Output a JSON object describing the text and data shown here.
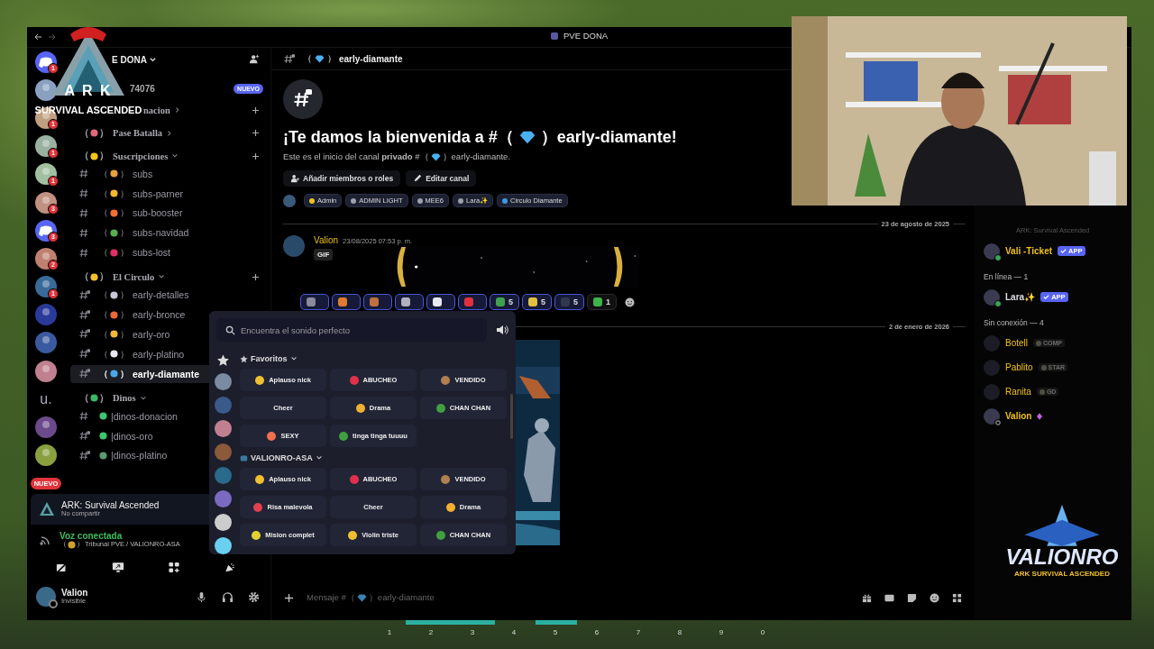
{
  "window": {
    "title": "PVE DONA"
  },
  "overlays": {
    "top_logo": {
      "title": "A R K",
      "subtitle": "SURVIVAL ASCENDED"
    },
    "bottom_logo": {
      "title": "VALIONRO",
      "subtitle": "ARK SURVIVAL ASCENDED"
    }
  },
  "server_rail": [
    {
      "kind": "discord",
      "badge": "1"
    },
    {
      "kind": "avatar"
    },
    {
      "kind": "avatar",
      "badge": "1"
    },
    {
      "kind": "avatar",
      "badge": "1"
    },
    {
      "kind": "avatar",
      "badge": "1"
    },
    {
      "kind": "avatar",
      "badge": "3"
    },
    {
      "kind": "discord",
      "badge": "3"
    },
    {
      "kind": "avatar",
      "badge": "2"
    },
    {
      "kind": "avatar",
      "badge": "1"
    },
    {
      "kind": "avatar"
    },
    {
      "kind": "avatar"
    },
    {
      "kind": "avatar"
    },
    {
      "kind": "text",
      "label": "u."
    },
    {
      "kind": "avatar"
    },
    {
      "kind": "avatar"
    },
    {
      "kind": "pill",
      "label": "NUEVO"
    }
  ],
  "server": {
    "name": "E DONA"
  },
  "channels": [
    {
      "kind": "partial",
      "label": "74076",
      "badge": "NUEVO"
    },
    {
      "kind": "partial-category",
      "label": "nacion",
      "expanded": false,
      "addable": true
    },
    {
      "kind": "category",
      "left": "（",
      "right": "）",
      "color": "#e0687a",
      "label": "Pase Batalla",
      "expanded": false,
      "addable": true
    },
    {
      "kind": "category",
      "left": "（",
      "right": "）",
      "color": "#f5c518",
      "label": "Suscripciones",
      "expanded": true,
      "addable": true
    },
    {
      "kind": "channel",
      "left": "（",
      "right": "）",
      "color": "#e8a040",
      "label": "subs",
      "locked": false,
      "selected": false
    },
    {
      "kind": "channel",
      "left": "（",
      "right": "）",
      "color": "#f5b630",
      "label": "subs-parner",
      "locked": false,
      "selected": false
    },
    {
      "kind": "channel",
      "left": "（",
      "right": "）",
      "color": "#f07030",
      "label": "sub-booster",
      "locked": false,
      "selected": false
    },
    {
      "kind": "channel",
      "left": "（",
      "right": "）",
      "color": "#58b050",
      "label": "subs-navidad",
      "locked": false,
      "selected": false
    },
    {
      "kind": "channel",
      "left": "（",
      "right": "）",
      "color": "#e0306a",
      "label": "subs-lost",
      "locked": false,
      "selected": false
    },
    {
      "kind": "category",
      "left": "（",
      "right": "）",
      "color": "#f5c030",
      "label": "El Circulo",
      "expanded": true,
      "addable": true
    },
    {
      "kind": "channel",
      "left": "（",
      "right": "）",
      "color": "#c8c8d8",
      "label": "early-detalles",
      "locked": true,
      "selected": false
    },
    {
      "kind": "channel",
      "left": "（",
      "right": "）",
      "color": "#e86a3a",
      "label": "early-bronce",
      "locked": true,
      "selected": false
    },
    {
      "kind": "channel",
      "left": "（",
      "right": "）",
      "color": "#f2b63a",
      "label": "early-oro",
      "locked": true,
      "selected": false
    },
    {
      "kind": "channel",
      "left": "（",
      "right": "）",
      "color": "#e8e8f0",
      "label": "early-platino",
      "locked": true,
      "selected": false
    },
    {
      "kind": "channel",
      "left": "（",
      "right": "）",
      "color": "#4aa8e8",
      "label": "early-diamante",
      "locked": true,
      "selected": true
    },
    {
      "kind": "category",
      "left": "（",
      "right": "）",
      "color": "#3cb860",
      "label": "Dinos",
      "expanded": true
    },
    {
      "kind": "channel",
      "color": "#3cc870",
      "label": "|dinos-donacion",
      "locked": false,
      "selected": false
    },
    {
      "kind": "channel",
      "color": "#3cc870",
      "label": "|dinos-oro",
      "locked": true,
      "selected": false
    },
    {
      "kind": "channel",
      "color": "#5a9a70",
      "label": "|dinos-platino",
      "locked": true,
      "selected": false
    }
  ],
  "activity": {
    "title": "ARK: Survival Ascended",
    "subtitle": "No compartir"
  },
  "voice": {
    "status": "Voz conectada",
    "left": "（",
    "right": "）",
    "channel": "Tribunal PVE / VALIONRO-ASA"
  },
  "user": {
    "name": "Valion",
    "status": "Invisible"
  },
  "channel_header": {
    "left": "（",
    "right": "）",
    "name": "early-diamante"
  },
  "welcome": {
    "title_start": "¡Te damos la bienvenida a #（",
    "title_end": "）early-diamante!",
    "text_start": "Este es el inicio del canal **privado** #（",
    "text_end": "）early-diamante.",
    "buttons": [
      "Añadir miembros o roles",
      "Editar canal"
    ]
  },
  "roles": [
    {
      "label": "Admin",
      "color": "#f0c020"
    },
    {
      "label": "ADMIN LIGHT",
      "color": "#9ca0aa"
    },
    {
      "label": "MEE6",
      "color": "#9ca0aa"
    },
    {
      "label": "Lara✨",
      "color": "#9ca0aa"
    },
    {
      "label": "Circulo Diamante",
      "color": "#3a9ae0"
    }
  ],
  "messages": [
    {
      "date": "23 de agosto de 2025",
      "author": "Valion",
      "time": "23/08/2025 07:53 p. m.",
      "tag": "GIF",
      "reactions": [
        {
          "color": "#8a8a9a",
          "selected": true
        },
        {
          "color": "#e07a30",
          "selected": true
        },
        {
          "color": "#c07040",
          "selected": true
        },
        {
          "color": "#b0b0c0",
          "selected": true
        },
        {
          "color": "#e8e8f0",
          "selected": true
        },
        {
          "color": "#e03040",
          "selected": true
        },
        {
          "color": "#40a050",
          "count": "5",
          "selected": true
        },
        {
          "color": "#e0c040",
          "count": "5",
          "selected": true
        },
        {
          "color": "#303850",
          "count": "5",
          "selected": true
        },
        {
          "color": "#3cb44a",
          "count": "1",
          "selected": false
        }
      ]
    },
    {
      "date": "2 de enero de 2026",
      "kind": "picture"
    }
  ],
  "composer": {
    "hint_start": "Mensaje #（",
    "hint_end": "）early-diamante"
  },
  "members": [
    {
      "kind": "activity",
      "label": "ARK: Survival Ascended"
    },
    {
      "kind": "member",
      "name": "Vali -Ticket",
      "color": "#f0c020",
      "presence": {
        "kind": "online"
      },
      "tag": {
        "kind": "app",
        "label": "APP"
      },
      "dimmed": false
    },
    {
      "kind": "header",
      "label": "En línea — 1"
    },
    {
      "kind": "member",
      "name": "Lara✨",
      "color": "#dcdde2",
      "presence": {
        "kind": "online"
      },
      "tag": {
        "kind": "app",
        "label": "APP"
      },
      "dimmed": false
    },
    {
      "kind": "header",
      "label": "Sin conexión — 4"
    },
    {
      "kind": "member",
      "name": "Botell",
      "color": "#f0c020",
      "tag": {
        "kind": "role",
        "label": "COMP"
      },
      "dimmed": true
    },
    {
      "kind": "member",
      "name": "Pablito",
      "color": "#f0c020",
      "tag": {
        "kind": "role",
        "label": "STAR"
      },
      "dimmed": true
    },
    {
      "kind": "member",
      "name": "Ranita",
      "color": "#f0c020",
      "tag": {
        "kind": "role",
        "label": "GD"
      },
      "dimmed": true
    },
    {
      "kind": "member",
      "name": "Valion",
      "color": "#f0c020",
      "presence": {
        "kind": "invisible"
      },
      "booster": true,
      "dimmed": false
    }
  ],
  "soundboard": {
    "placeholder": "Encuentra el sonido perfecto",
    "sections": [
      {
        "title": "Favoritos",
        "kind": "favorites",
        "sounds": [
          {
            "label": "Aplauso nick",
            "color": "#f0c030"
          },
          {
            "label": "ABUCHEO",
            "color": "#e0304a"
          },
          {
            "label": "VENDIDO",
            "color": "#b08050"
          },
          {
            "label": "Cheer"
          },
          {
            "label": "Drama",
            "color": "#f0b030"
          },
          {
            "label": "CHAN CHAN",
            "color": "#40a040"
          },
          {
            "label": "SEXY",
            "color": "#f07050"
          },
          {
            "label": "tinga tinga tuuuu",
            "color": "#40a040"
          }
        ]
      },
      {
        "title": "VALIONRO-ASA",
        "kind": "server",
        "sounds": [
          {
            "label": "Aplauso nick",
            "color": "#f0c030"
          },
          {
            "label": "ABUCHEO",
            "color": "#e0304a"
          },
          {
            "label": "VENDIDO",
            "color": "#b08050"
          },
          {
            "label": "Risa malevola",
            "color": "#e04050"
          },
          {
            "label": "Cheer"
          },
          {
            "label": "Drama",
            "color": "#f0b030"
          },
          {
            "label": "Mision complet",
            "color": "#e0d030"
          },
          {
            "label": "Violin triste",
            "color": "#f0c030"
          },
          {
            "label": "CHAN CHAN",
            "color": "#40a040"
          }
        ]
      }
    ]
  },
  "hotbar": [
    "1",
    "2",
    "3",
    "4",
    "5",
    "6",
    "7",
    "8",
    "9",
    "0"
  ]
}
